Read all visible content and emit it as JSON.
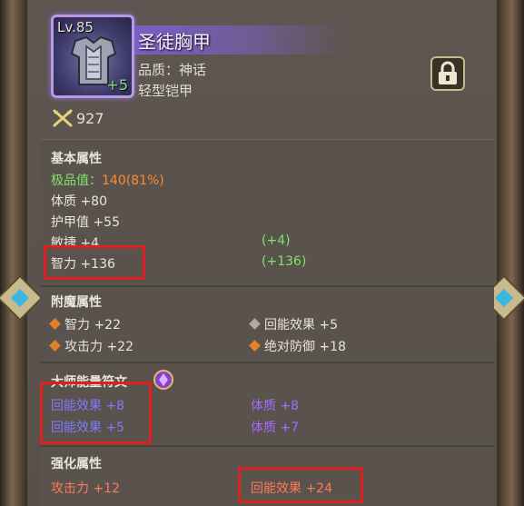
{
  "item": {
    "level": "Lv.85",
    "enhance": "+5",
    "name": "圣徒胸甲",
    "quality": "品质：神话",
    "type": "轻型铠甲",
    "power": "927"
  },
  "base": {
    "title": "基本属性",
    "extreme_label": "极品值：",
    "extreme_value": "140(81%)",
    "stats": [
      {
        "label": "体质 +80",
        "bonus": ""
      },
      {
        "label": "护甲值 +55",
        "bonus": ""
      },
      {
        "label": "敏捷 +4",
        "bonus": "(+4)"
      },
      {
        "label": "智力 +136",
        "bonus": "(+136)"
      }
    ]
  },
  "enchant": {
    "title": "附魔属性",
    "items": [
      {
        "label": "智力 +22"
      },
      {
        "label": "回能效果 +5"
      },
      {
        "label": "攻击力 +22"
      },
      {
        "label": "绝对防御 +18"
      }
    ]
  },
  "master": {
    "title": "大师能量符文",
    "items": [
      {
        "label": "回能效果 +8"
      },
      {
        "label": "体质 +8"
      },
      {
        "label": "回能效果 +5"
      },
      {
        "label": "体质 +7"
      }
    ]
  },
  "enhanced": {
    "title": "强化属性",
    "items": [
      {
        "label": "攻击力 +12"
      },
      {
        "label": "回能效果 +24"
      }
    ]
  },
  "icons": {
    "lock": "lock-icon",
    "power": "crossed-swords-icon",
    "rune": "rune-gem-icon",
    "gem": "side-gem-icon"
  },
  "colors": {
    "extreme_label": "#7ee36a",
    "extreme_value": "#ff8a30",
    "bonus": "#7ee36a",
    "master_left": "#7f7aff",
    "master_right": "#a56bff",
    "enhanced": "#ff7a5a",
    "highlight_box": "#e02020"
  }
}
